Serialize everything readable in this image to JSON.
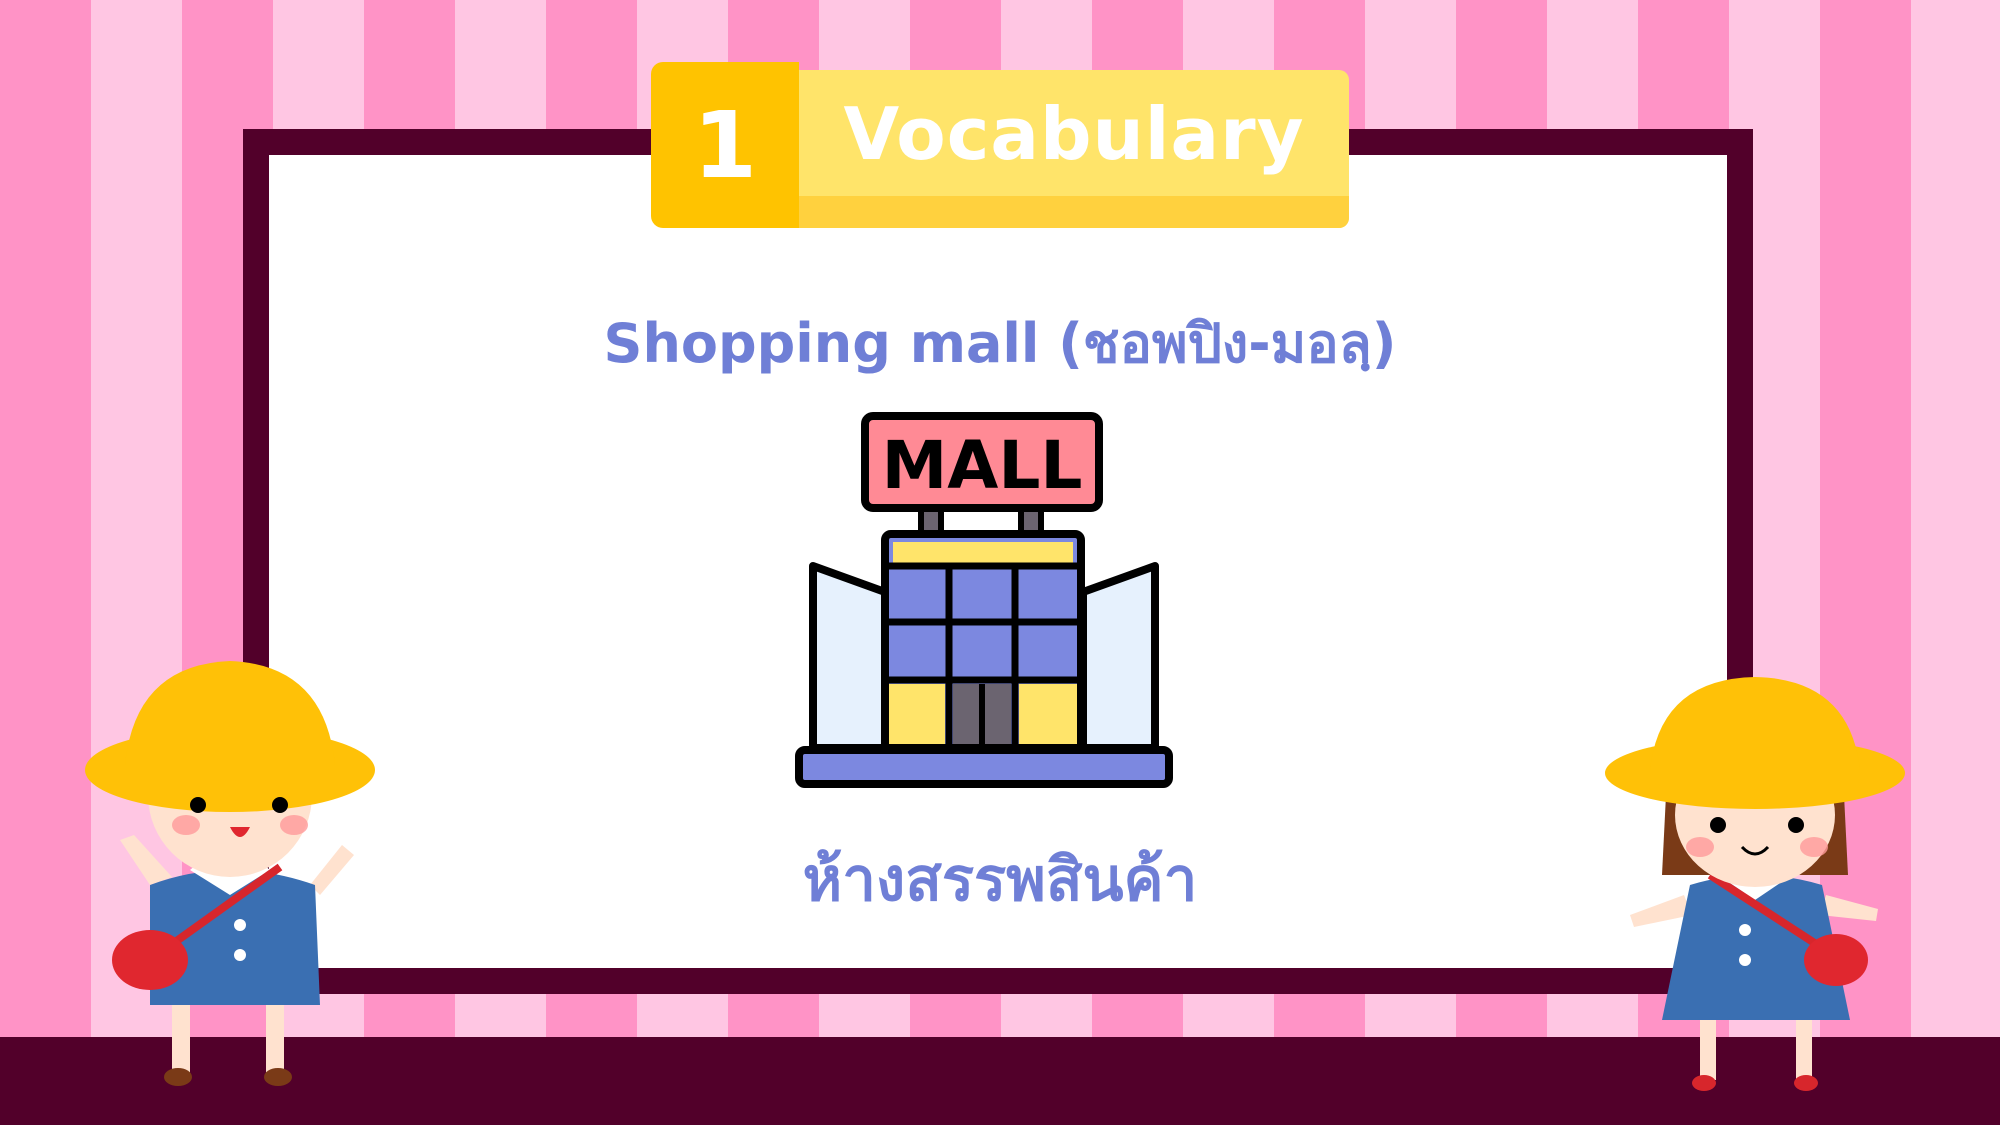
{
  "lesson": {
    "number": "1",
    "title": "Vocabulary"
  },
  "vocab": {
    "word": "Shopping mall (ชอพปิง-มอลฺ)",
    "meaning": "ห้างสรรพสินค้า",
    "image_sign_text": "MALL",
    "icon": "shopping-mall-building-icon"
  },
  "colors": {
    "stripe_dark": "#ff93c6",
    "stripe_light": "#ffc6e3",
    "frame": "#52002a",
    "tab_number": "#ffc300",
    "tab_label": "#ffe46a",
    "text_accent": "#6f7fd6"
  }
}
